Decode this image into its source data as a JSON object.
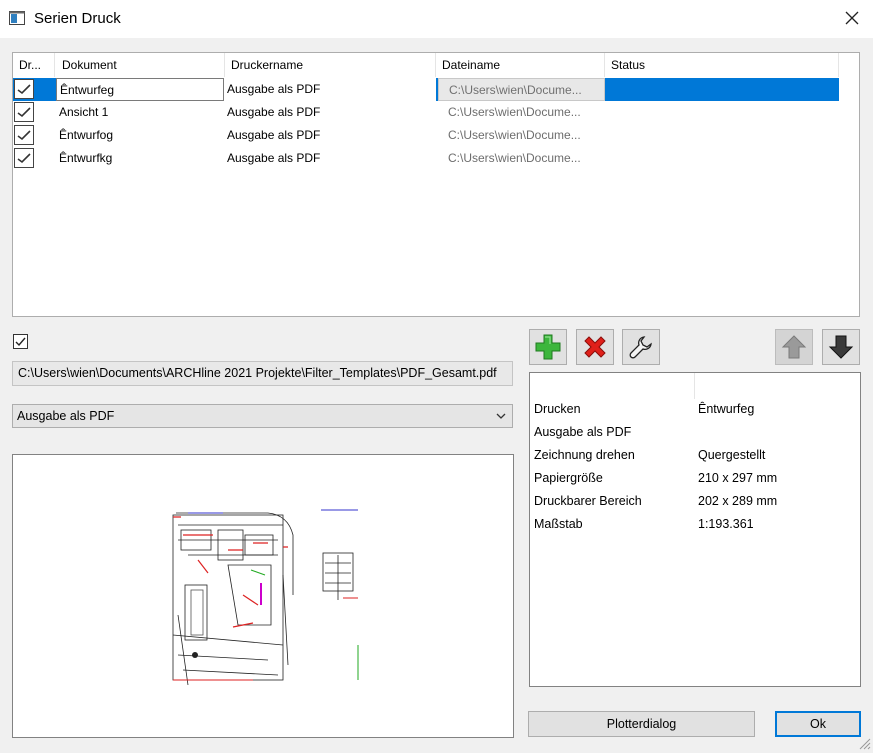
{
  "window": {
    "title": "Serien Druck",
    "close_icon": "close-icon"
  },
  "table": {
    "columns": [
      "Dr...",
      "Dokument",
      "Druckername",
      "Dateiname",
      "Status"
    ],
    "rows": [
      {
        "checked": true,
        "dokument": "Êntwurfeg",
        "drucker": "Ausgabe als PDF",
        "datei": "C:\\Users\\wien\\Docume...",
        "status": ""
      },
      {
        "checked": true,
        "dokument": "Ansicht 1",
        "drucker": "Ausgabe als PDF",
        "datei": "C:\\Users\\wien\\Docume...",
        "status": ""
      },
      {
        "checked": true,
        "dokument": "Êntwurfog",
        "drucker": "Ausgabe als PDF",
        "datei": "C:\\Users\\wien\\Docume...",
        "status": ""
      },
      {
        "checked": true,
        "dokument": "Êntwurfkg",
        "drucker": "Ausgabe als PDF",
        "datei": "C:\\Users\\wien\\Docume...",
        "status": ""
      }
    ]
  },
  "output": {
    "checked": true,
    "path": "C:\\Users\\wien\\Documents\\ARCHline 2021 Projekte\\Filter_Templates\\PDF_Gesamt.pdf",
    "printer": "Ausgabe als PDF"
  },
  "toolbar": {
    "add_icon": "plus-icon",
    "delete_icon": "delete-icon",
    "settings_icon": "wrench-icon",
    "up_icon": "arrow-up-icon",
    "down_icon": "arrow-down-icon"
  },
  "properties": [
    {
      "key": "Drucken",
      "value": "Êntwurfeg"
    },
    {
      "key": "Ausgabe als PDF",
      "value": ""
    },
    {
      "key": "Zeichnung drehen",
      "value": "Quergestellt"
    },
    {
      "key": "Papiergröße",
      "value": "210 x 297 mm"
    },
    {
      "key": "Druckbarer Bereich",
      "value": "202 x 289 mm"
    },
    {
      "key": "Maßstab",
      "value": "1:193.361"
    }
  ],
  "buttons": {
    "plotter": "Plotterdialog",
    "ok": "Ok"
  },
  "colors": {
    "selection": "#0078d7",
    "add_green": "#3cb63c",
    "delete_red": "#e0201a"
  }
}
